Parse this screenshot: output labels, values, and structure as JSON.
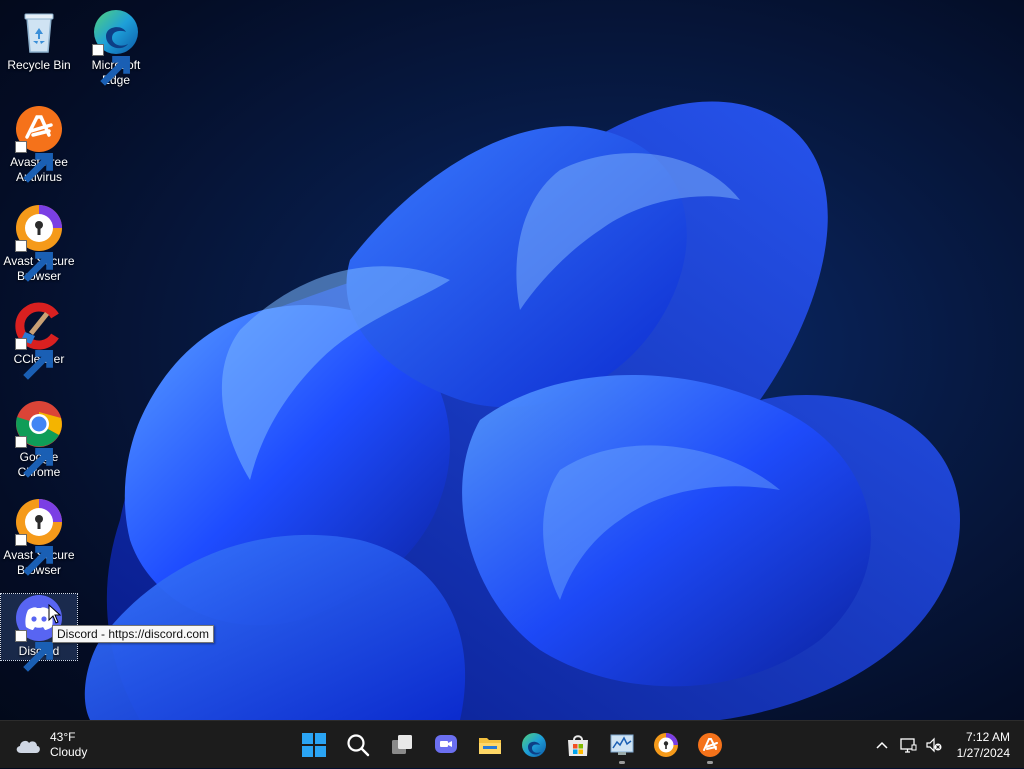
{
  "desktop": {
    "icons": [
      {
        "label": "Recycle Bin",
        "icon": "recycle-bin-icon"
      },
      {
        "label": "Microsoft Edge",
        "icon": "edge-icon"
      },
      {
        "label": "Avast Free Antivirus",
        "icon": "avast-antivirus-icon"
      },
      {
        "label": "Avast Secure Browser",
        "icon": "avast-secure-browser-icon"
      },
      {
        "label": "CCleaner",
        "icon": "ccleaner-icon"
      },
      {
        "label": "Google Chrome",
        "icon": "chrome-icon"
      },
      {
        "label": "Avast Secure Browser",
        "icon": "avast-secure-browser-icon"
      },
      {
        "label": "Discord",
        "icon": "discord-icon"
      }
    ],
    "tooltip": "Discord - https://discord.com"
  },
  "taskbar": {
    "weather": {
      "temp": "43°F",
      "condition": "Cloudy",
      "icon": "cloud-icon"
    },
    "apps": [
      {
        "name": "Start",
        "icon": "windows-start-icon"
      },
      {
        "name": "Search",
        "icon": "search-icon"
      },
      {
        "name": "Task View",
        "icon": "task-view-icon"
      },
      {
        "name": "Chat",
        "icon": "chat-icon"
      },
      {
        "name": "File Explorer",
        "icon": "file-explorer-icon"
      },
      {
        "name": "Microsoft Edge",
        "icon": "edge-icon"
      },
      {
        "name": "Microsoft Store",
        "icon": "store-icon"
      },
      {
        "name": "Performance Monitor",
        "icon": "monitor-icon"
      },
      {
        "name": "Avast Secure Browser",
        "icon": "avast-secure-browser-icon"
      },
      {
        "name": "Avast Free Antivirus",
        "icon": "avast-antivirus-icon"
      }
    ],
    "tray": {
      "time": "7:12 AM",
      "date": "1/27/2024",
      "icons": [
        "chevron-up-icon",
        "network-icon",
        "volume-muted-icon"
      ]
    }
  },
  "colors": {
    "taskbar": "#1c1c1c",
    "accent": "#0078d4",
    "wallpaper_blue": "#1a4dff"
  }
}
